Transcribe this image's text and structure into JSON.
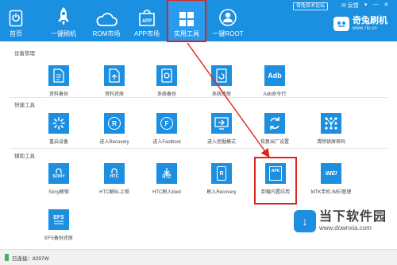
{
  "header": {
    "nav": [
      {
        "label": "首页",
        "icon": "home-phone-icon"
      },
      {
        "label": "一键刷机",
        "icon": "rocket-icon"
      },
      {
        "label": "ROM市场",
        "icon": "cloud-icon"
      },
      {
        "label": "APP市场",
        "icon": "app-bag-icon"
      },
      {
        "label": "实用工具",
        "icon": "grid-icon",
        "active": true
      },
      {
        "label": "一键ROOT",
        "icon": "shield-user-icon"
      }
    ],
    "forum_label": "奇兔技术论坛",
    "feedback_label": "反馈",
    "brand_name": "奇兔刷机",
    "brand_url": "www.7to.cn"
  },
  "sections": [
    {
      "title": "设备管理",
      "tools": [
        {
          "label": "资料备份",
          "icon": "backup-icon"
        },
        {
          "label": "资料还原",
          "icon": "restore-icon"
        },
        {
          "label": "系统备份",
          "icon": "system-backup-icon"
        },
        {
          "label": "系统还原",
          "icon": "system-restore-icon"
        },
        {
          "label": "Adb命令行",
          "icon": "adb-icon",
          "text": "Adb"
        }
      ]
    },
    {
      "title": "快捷工具",
      "tools": [
        {
          "label": "重启设备",
          "icon": "reboot-icon"
        },
        {
          "label": "进入Recovery",
          "icon": "recovery-icon",
          "text": "R"
        },
        {
          "label": "进入Fastboot",
          "icon": "fastboot-icon",
          "text": "F"
        },
        {
          "label": "进入挖掘模式",
          "icon": "dig-mode-icon"
        },
        {
          "label": "恢复出厂设置",
          "icon": "factory-reset-icon"
        },
        {
          "label": "清除锁屏密码",
          "icon": "unlock-pattern-icon"
        }
      ]
    },
    {
      "title": "辅助工具",
      "tools": [
        {
          "label": "Sony解锁",
          "icon": "sony-icon",
          "text": "SONY"
        },
        {
          "label": "HTC解BL上锁",
          "icon": "htc-unlock-icon",
          "text": "HTC"
        },
        {
          "label": "HTC刷入boot",
          "icon": "htc-boot-icon",
          "text": "HTC"
        },
        {
          "label": "刷入Recovery",
          "icon": "flash-recovery-icon",
          "text": "R"
        },
        {
          "label": "卸载内置应用",
          "icon": "apk-uninstall-icon",
          "text": "APK"
        },
        {
          "label": "MTK手机 IMEI管理",
          "icon": "imei-icon",
          "text": "IMEI"
        },
        {
          "label": "EFS备份还原",
          "icon": "efs-icon",
          "text": "EFS"
        }
      ]
    }
  ],
  "status": {
    "text": "已连接：8297W"
  },
  "watermark": {
    "name": "当下软件园",
    "url": "www.downxia.com"
  },
  "colors": {
    "header_bg": "#1b8fe0",
    "tile_bg": "#1d8fe1",
    "highlight": "#e0241b"
  }
}
